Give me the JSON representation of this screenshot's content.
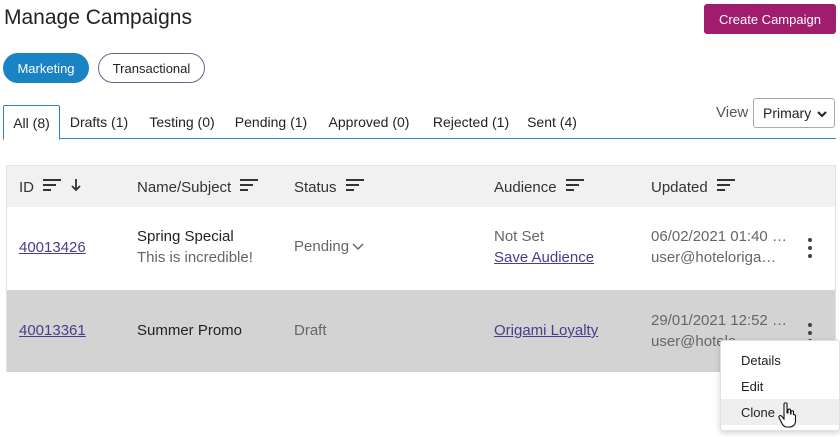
{
  "header": {
    "title": "Manage Campaigns",
    "create_button": "Create Campaign"
  },
  "campaign_types": [
    "Marketing",
    "Transactional"
  ],
  "active_campaign_type": "Marketing",
  "tabs": [
    {
      "label": "All (8)",
      "active": true
    },
    {
      "label": "Drafts (1)",
      "active": false
    },
    {
      "label": "Testing (0)",
      "active": false
    },
    {
      "label": "Pending (1)",
      "active": false
    },
    {
      "label": "Approved (0)",
      "active": false
    },
    {
      "label": "Rejected (1)",
      "active": false
    },
    {
      "label": "Sent (4)",
      "active": false
    }
  ],
  "view": {
    "label": "View",
    "selected": "Primary"
  },
  "table": {
    "columns": [
      "ID",
      "Name/Subject",
      "Status",
      "Audience",
      "Updated"
    ],
    "rows": [
      {
        "id": "40013426",
        "name": "Spring Special",
        "subject": "This is incredible!",
        "status": "Pending",
        "audience": "Not Set",
        "audience_link": "Save Audience",
        "updated_date": "06/02/2021 01:40 …",
        "updated_by": "user@hoteloriga…"
      },
      {
        "id": "40013361",
        "name": "Summer Promo",
        "subject": "",
        "status": "Draft",
        "audience": "",
        "audience_link": "Origami Loyalty",
        "updated_date": "29/01/2021 12:52 …",
        "updated_by": "user@hotelo"
      }
    ]
  },
  "row_menu": {
    "items": [
      "Details",
      "Edit",
      "Clone"
    ],
    "hovered": "Clone"
  },
  "colors": {
    "primary_button": "#a01d6e",
    "active_pill": "#1a83c4",
    "tab_border": "#2a86c6",
    "link": "#4a3c8c",
    "selected_row": "#d3d3d3"
  }
}
